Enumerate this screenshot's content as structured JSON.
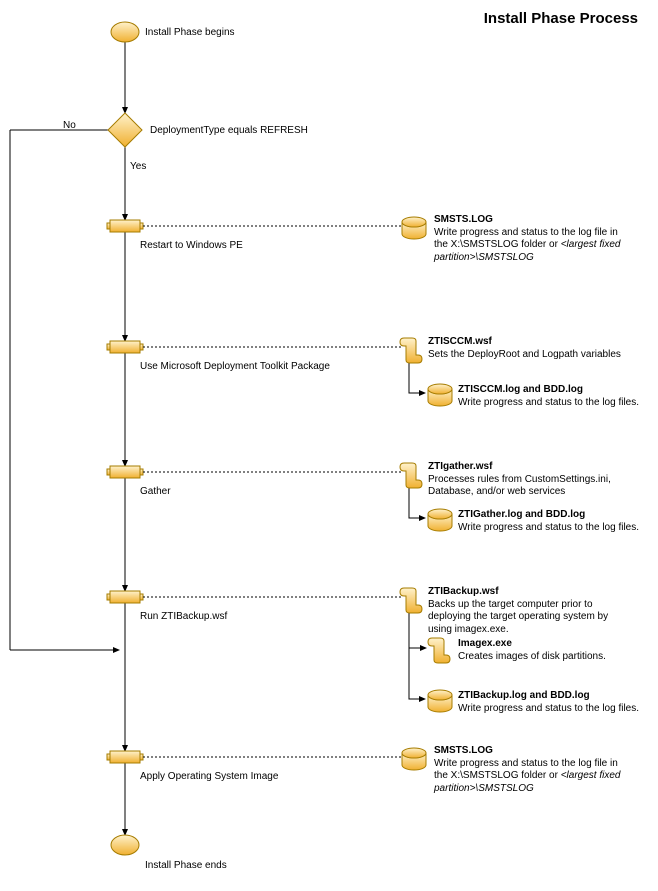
{
  "title": "Install Phase Process",
  "start": "Install Phase begins",
  "end": "Install Phase ends",
  "decision": {
    "label": "DeploymentType equals REFRESH",
    "no": "No",
    "yes": "Yes"
  },
  "steps": {
    "restart": {
      "label": "Restart to Windows PE",
      "db_title": "SMSTS.LOG",
      "db_desc": "Write progress and status to the log file in the X:\\SMSTSLOG folder or ",
      "db_desc_italic": "<largest fixed partition>\\SMSTSLOG"
    },
    "mdt": {
      "label": "Use Microsoft Deployment Toolkit Package",
      "script_title": "ZTISCCM.wsf",
      "script_desc": "Sets the DeployRoot and Logpath variables",
      "db_title": "ZTISCCM.log and BDD.log",
      "db_desc": "Write progress and status to the log files."
    },
    "gather": {
      "label": "Gather",
      "script_title": "ZTIgather.wsf",
      "script_desc": "Processes rules from CustomSettings.ini, Database, and/or web services",
      "db_title": "ZTIGather.log and BDD.log",
      "db_desc": "Write progress and status to the log files."
    },
    "backup": {
      "label": "Run ZTIBackup.wsf",
      "script_title": "ZTIBackup.wsf",
      "script_desc": "Backs up the target computer prior to deploying the target operating system by using imagex.exe.",
      "sub_title": "Imagex.exe",
      "sub_desc": "Creates images of disk partitions.",
      "db_title": "ZTIBackup.log and BDD.log",
      "db_desc": "Write progress and status to the log files."
    },
    "apply": {
      "label": "Apply Operating System Image",
      "db_title": "SMSTS.LOG",
      "db_desc": "Write progress and status to the log file in the X:\\SMSTSLOG folder or ",
      "db_desc_italic": "<largest fixed partition>\\SMSTSLOG"
    }
  }
}
